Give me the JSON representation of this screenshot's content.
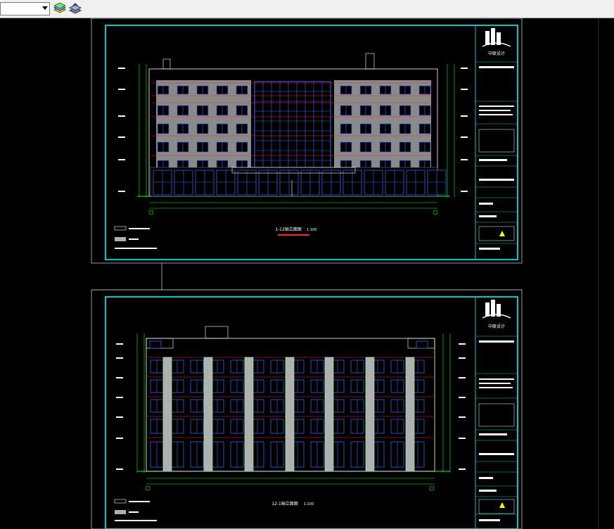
{
  "toolbar": {
    "layer_combo_value": "",
    "icons": [
      "layer-properties-icon",
      "layer-states-icon"
    ]
  },
  "drawing": {
    "sheets": [
      {
        "id": "upper",
        "title": "1-12轴立面图",
        "scale": "1:100",
        "company": "中联设计"
      },
      {
        "id": "lower",
        "title": "12-1轴立面图",
        "scale": "1:100",
        "company": "中联设计"
      }
    ]
  },
  "colors": {
    "frame": "#00c8c8",
    "dim": "#00ff00",
    "window": "#3b6cff",
    "wall_gray": "#9a9a9a",
    "red_line": "#ff2020",
    "pilaster": "#b0b0b0"
  }
}
